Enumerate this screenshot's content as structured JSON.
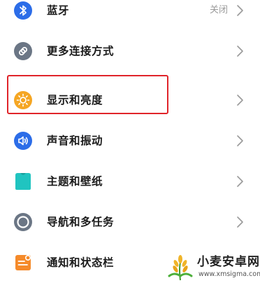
{
  "colors": {
    "bluetooth_icon": "#2c6de8",
    "link_icon": "#6b7685",
    "display_icon": "#f5a623",
    "sound_icon": "#2c6de8",
    "theme_icon": "#20c4c0",
    "navigation_icon": "#6b7685",
    "notification_icon": "#f58a2a",
    "highlight_border": "#e0242a",
    "chevron": "#9a9a9a"
  },
  "settings": {
    "items": [
      {
        "label": "蓝牙",
        "value": "关闭",
        "icon": "bluetooth-icon"
      },
      {
        "label": "更多连接方式",
        "icon": "link-icon"
      },
      {
        "label": "显示和亮度",
        "icon": "sun-icon"
      },
      {
        "label": "声音和振动",
        "icon": "speaker-icon"
      },
      {
        "label": "主题和壁纸",
        "icon": "shirt-icon"
      },
      {
        "label": "导航和多任务",
        "icon": "navigation-circle-icon"
      },
      {
        "label": "通知和状态栏",
        "icon": "notification-icon"
      }
    ]
  },
  "watermark": {
    "title": "小麦安卓网",
    "url": "www.xmsigma.com"
  }
}
